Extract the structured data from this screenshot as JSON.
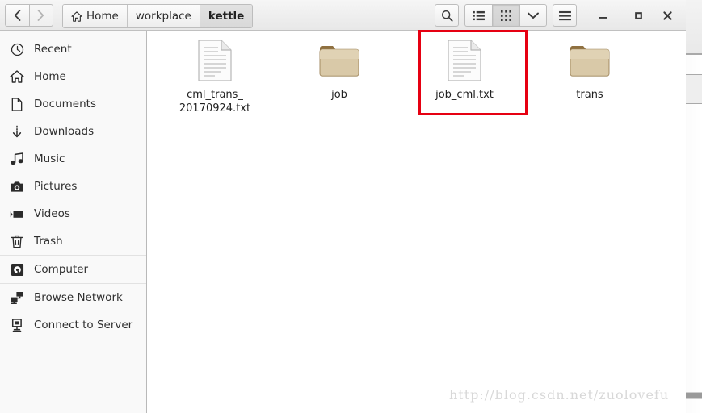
{
  "window": {
    "nav": {
      "back_label": "‹",
      "forward_label": "›"
    },
    "breadcrumb": [
      {
        "label": "Home",
        "icon": "home-icon",
        "current": false
      },
      {
        "label": "workplace",
        "icon": "",
        "current": false
      },
      {
        "label": "kettle",
        "icon": "",
        "current": true
      }
    ],
    "toolbar": {
      "search_label": "search-icon",
      "list_view_label": "list-view-icon",
      "grid_view_label": "grid-view-icon",
      "view_dropdown_label": "chevron-down-icon",
      "menu_label": "hamburger-menu-icon",
      "active_view": "grid"
    },
    "controls": {
      "minimize_label": "–",
      "maximize_label": "□",
      "close_label": "✕"
    }
  },
  "sidebar": {
    "items": [
      {
        "label": "Recent",
        "icon": "clock-icon",
        "selected": false,
        "sep_above": false
      },
      {
        "label": "Home",
        "icon": "home-icon",
        "selected": false,
        "sep_above": false
      },
      {
        "label": "Documents",
        "icon": "document-icon",
        "selected": false,
        "sep_above": false
      },
      {
        "label": "Downloads",
        "icon": "download-icon",
        "selected": false,
        "sep_above": false
      },
      {
        "label": "Music",
        "icon": "music-icon",
        "selected": false,
        "sep_above": false
      },
      {
        "label": "Pictures",
        "icon": "camera-icon",
        "selected": false,
        "sep_above": false
      },
      {
        "label": "Videos",
        "icon": "video-icon",
        "selected": false,
        "sep_above": false
      },
      {
        "label": "Trash",
        "icon": "trash-icon",
        "selected": false,
        "sep_above": false
      },
      {
        "label": "Computer",
        "icon": "computer-icon",
        "selected": false,
        "sep_above": true
      },
      {
        "label": "Browse Network",
        "icon": "network-icon",
        "selected": false,
        "sep_above": true
      },
      {
        "label": "Connect to Server",
        "icon": "server-icon",
        "selected": false,
        "sep_above": false
      }
    ]
  },
  "files": [
    {
      "name": "cml_trans_\n20170924.txt",
      "type": "text-file",
      "highlighted": false
    },
    {
      "name": "job",
      "type": "folder",
      "highlighted": false
    },
    {
      "name": "job_cml.txt",
      "type": "text-file",
      "highlighted": true
    },
    {
      "name": "trans",
      "type": "folder",
      "highlighted": false
    }
  ],
  "annotation": {
    "shape": "rectangle",
    "color": "#e60012",
    "target": "job_cml.txt"
  },
  "watermark": {
    "text": "http://blog.csdn.net/zuolovefu"
  },
  "colors": {
    "annotation_red": "#e60012",
    "folder_body": "#d9c9a8",
    "folder_tab": "#8f7040",
    "sidebar_bg": "#f9f9f9",
    "header_bg": "#eeeeee"
  }
}
